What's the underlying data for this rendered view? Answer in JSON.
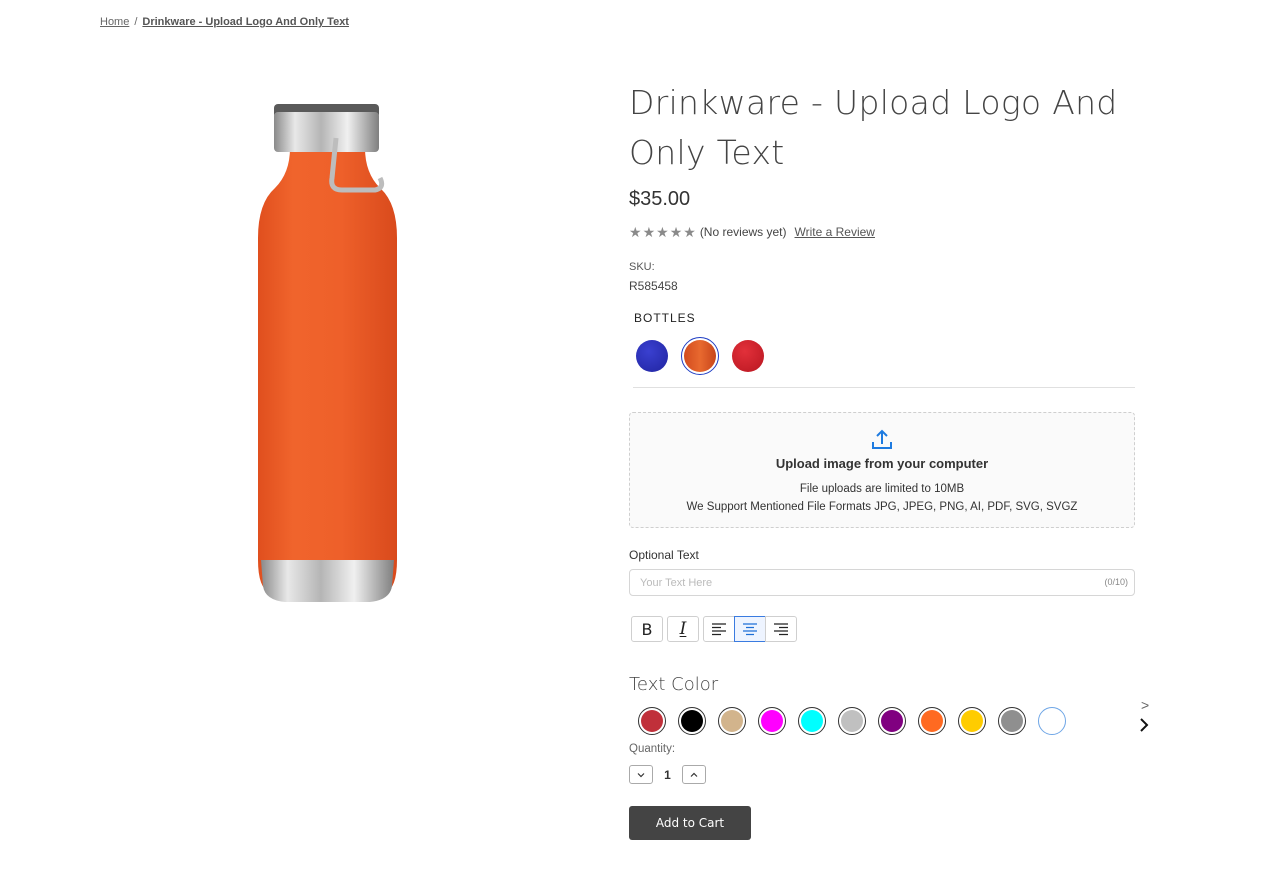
{
  "breadcrumb": {
    "home": "Home",
    "separator": "/",
    "current": "Drinkware - Upload Logo And Only Text"
  },
  "product": {
    "title": "Drinkware - Upload Logo And Only Text",
    "price": "$35.00",
    "rating": {
      "stars": 5,
      "filled": 0,
      "reviews_text": "(No reviews yet)",
      "write_review": "Write a Review"
    },
    "sku_label": "SKU:",
    "sku": "R585458",
    "image_icon": "orange-bottle-image"
  },
  "bottles": {
    "label": "BOTTLES",
    "options": [
      {
        "name": "blue",
        "color": "#2b2fb5"
      },
      {
        "name": "orange",
        "color": "#e2572a",
        "selected": true
      },
      {
        "name": "red",
        "color": "#d41f2b"
      }
    ]
  },
  "upload": {
    "icon": "upload-icon",
    "title": "Upload image from your computer",
    "limit": "File uploads are limited to 10MB",
    "formats": "We Support Mentioned File Formats JPG, JPEG, PNG, AI, PDF, SVG, SVGZ"
  },
  "optional_text": {
    "label": "Optional Text",
    "placeholder": "Your Text Here",
    "value": "",
    "counter": "(0/10)"
  },
  "format_buttons": {
    "bold": "B",
    "italic": "I",
    "active_align": "center"
  },
  "text_color": {
    "label": "Text Color",
    "colors": [
      "#c0303a",
      "#000000",
      "#d2b48c",
      "#ff00ff",
      "#00ffff",
      "#c0c0c0",
      "#800080",
      "#ff6a21",
      "#ffcc00",
      "#8f8f8f",
      "#ffffff"
    ],
    "next_small": ">"
  },
  "quantity": {
    "label": "Quantity:",
    "value": "1"
  },
  "cart": {
    "label": "Add to Cart"
  }
}
